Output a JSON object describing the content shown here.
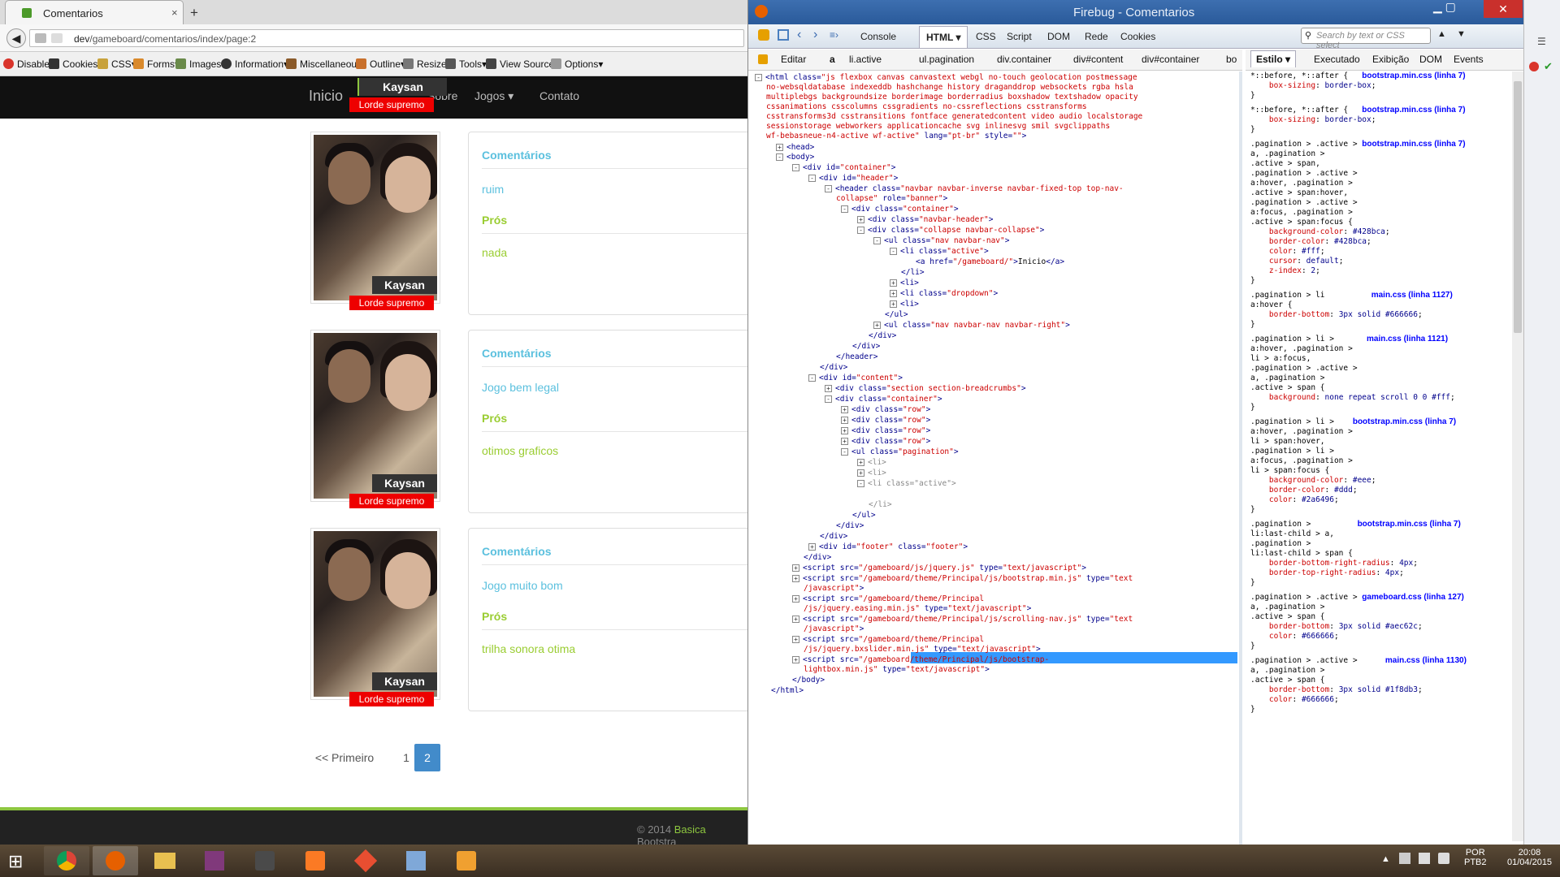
{
  "browser": {
    "tab_title": "Comentarios",
    "new_tab_symbol": "+",
    "close_symbol": "×",
    "url_host": "dev",
    "url_path": "/gameboard/comentarios/index/page:2",
    "webdev_items": [
      "Disable",
      "Cookies",
      "CSS",
      "Forms",
      "Images",
      "Information",
      "Miscellaneous",
      "Outline",
      "Resize",
      "Tools",
      "View Source",
      "Options"
    ]
  },
  "site": {
    "nav": {
      "home": "Inicio",
      "about": "Sobre",
      "games": "Jogos",
      "contact": "Contato"
    },
    "nav_user": {
      "name": "Kaysan",
      "rank": "Lorde supremo"
    },
    "comments": [
      {
        "user": "Kaysan",
        "rank": "Lorde supremo",
        "heading": "Comentários",
        "comment": "ruim",
        "pros_label": "Prós",
        "pros": "nada"
      },
      {
        "user": "Kaysan",
        "rank": "Lorde supremo",
        "heading": "Comentários",
        "comment": "Jogo bem legal",
        "pros_label": "Prós",
        "pros": "otimos graficos"
      },
      {
        "user": "Kaysan",
        "rank": "Lorde supremo",
        "heading": "Comentários",
        "comment": "Jogo muito bom",
        "pros_label": "Prós",
        "pros": "trilha sonora otima"
      }
    ],
    "pagination": {
      "first": "<< Primeiro",
      "pages": [
        "1",
        "2"
      ],
      "active": "2"
    },
    "footer": {
      "prefix": "© 2014 ",
      "brand": "Basica",
      "suffix": " Bootstra"
    }
  },
  "firebug": {
    "title": "Firebug - Comentarios",
    "tabs": [
      "Console",
      "HTML",
      "CSS",
      "Script",
      "DOM",
      "Rede",
      "Cookies"
    ],
    "active_tab": "HTML",
    "search_placeholder": "Search by text or CSS select",
    "edit_label": "Editar",
    "breadcrumbs": [
      "a",
      "li.active",
      "ul.pagination",
      "div.container",
      "div#content",
      "div#container",
      "bo"
    ],
    "side_tabs": [
      "Estilo",
      "Executado",
      "Exibição",
      "DOM",
      "Events"
    ],
    "active_side_tab": "Estilo"
  },
  "taskbar": {
    "lang": "POR\nPTB2",
    "time": "20:08",
    "date": "01/04/2015"
  }
}
